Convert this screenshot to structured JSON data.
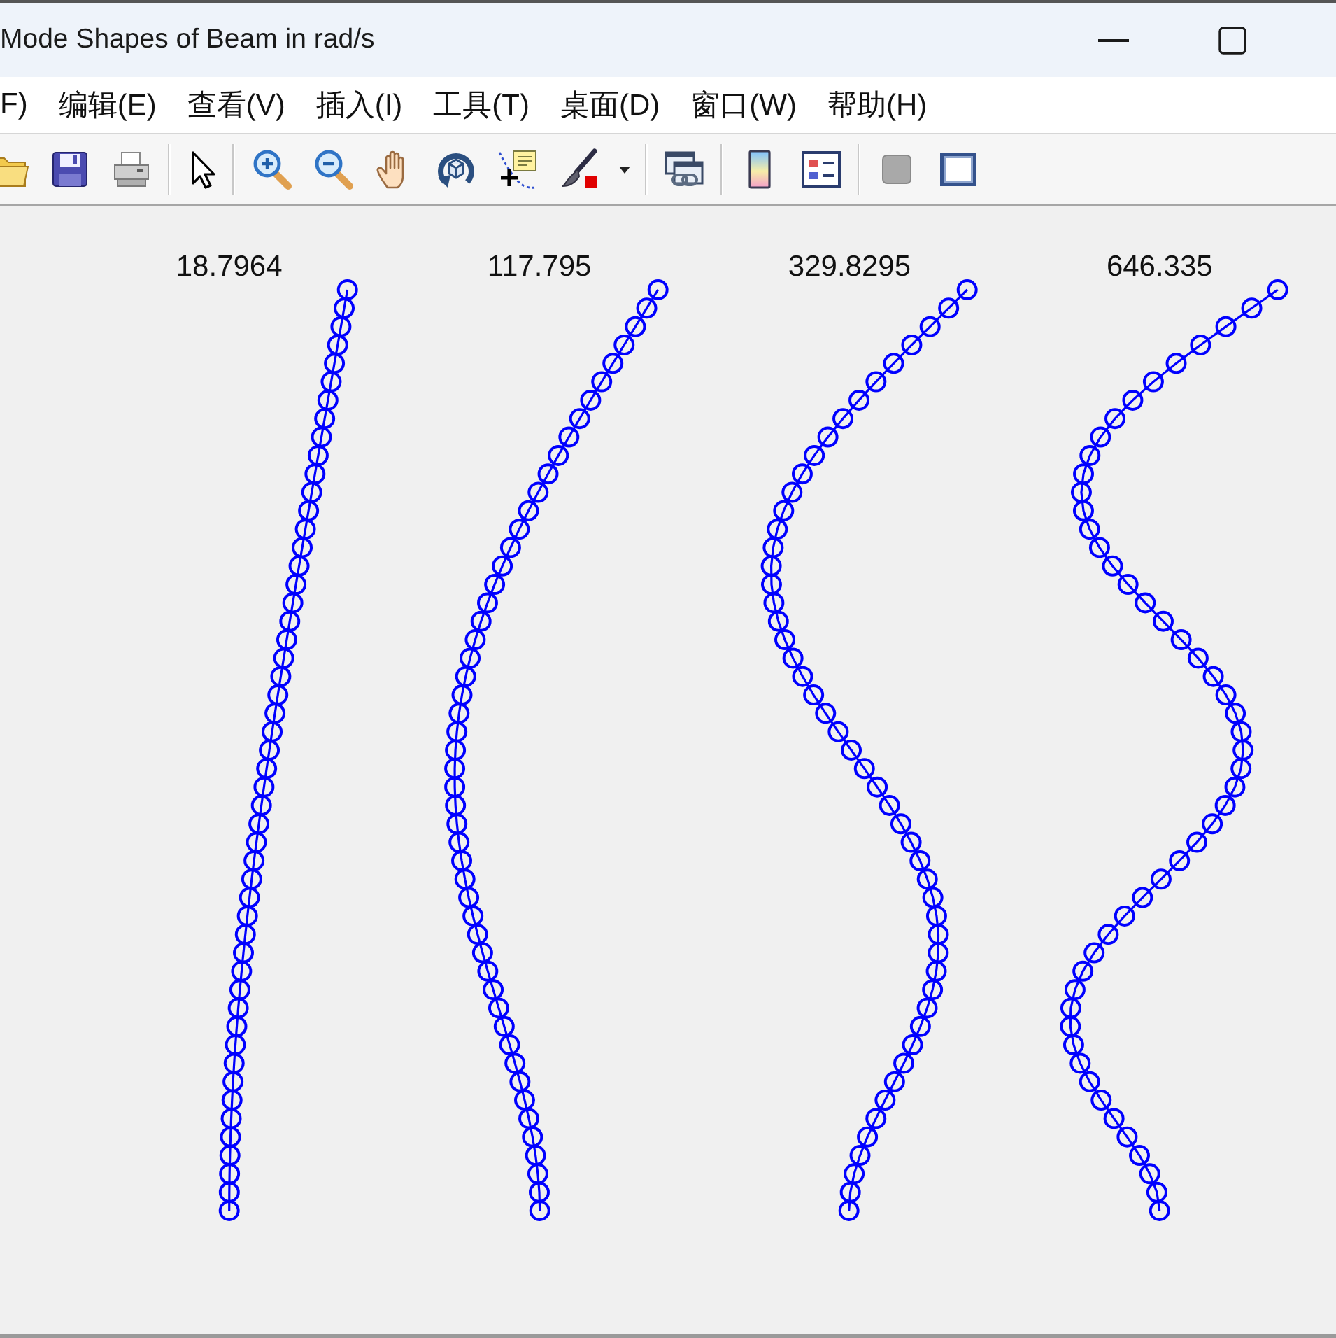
{
  "window": {
    "title": "Mode Shapes of Beam in rad/s"
  },
  "menus": [
    "F)",
    "编辑(E)",
    "查看(V)",
    "插入(I)",
    "工具(T)",
    "桌面(D)",
    "窗口(W)",
    "帮助(H)"
  ],
  "subplots": [
    {
      "title": "18.7964"
    },
    {
      "title": "117.795"
    },
    {
      "title": "329.8295"
    },
    {
      "title": "646.335"
    }
  ]
}
